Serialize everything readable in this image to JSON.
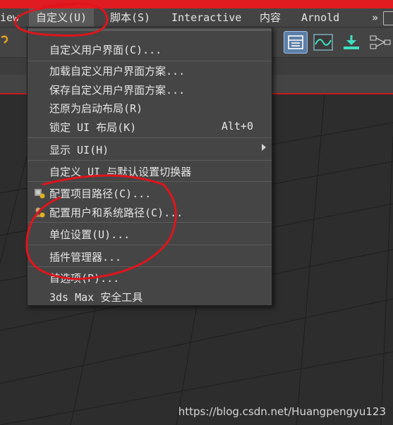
{
  "menubar": {
    "items": [
      {
        "label": "iew"
      },
      {
        "label": "自定义(U)"
      },
      {
        "label": "脚本(S)"
      },
      {
        "label": "Interactive"
      },
      {
        "label": "内容"
      },
      {
        "label": "Arnold"
      },
      {
        "label": "»"
      }
    ]
  },
  "toolbar": {
    "icons": [
      "layout-icon",
      "curve-editor-icon",
      "download-icon",
      "schematic-view-icon"
    ]
  },
  "dropdown": {
    "items": [
      {
        "label": "自定义用户界面(C)..."
      },
      {
        "label": "加载自定义用户界面方案..."
      },
      {
        "label": "保存自定义用户界面方案..."
      },
      {
        "label": "还原为启动布局(R)"
      },
      {
        "label": "锁定 UI 布局(K)",
        "shortcut": "Alt+0"
      },
      {
        "label": "显示 UI(H)"
      },
      {
        "label": "自定义 UI 与默认设置切换器"
      },
      {
        "label": "配置项目路径(C)..."
      },
      {
        "label": "配置用户和系统路径(C)..."
      },
      {
        "label": "单位设置(U)..."
      },
      {
        "label": "插件管理器..."
      },
      {
        "label": "首选项(P)..."
      },
      {
        "label": "3ds Max 安全工具"
      }
    ]
  },
  "watermark": "https://blog.csdn.net/Huangpengyu123",
  "colors": {
    "accent_red": "#e11b22",
    "annotation_red": "#e0141c",
    "menu_bg": "#454545",
    "highlight_blue": "#5d7ea6"
  }
}
